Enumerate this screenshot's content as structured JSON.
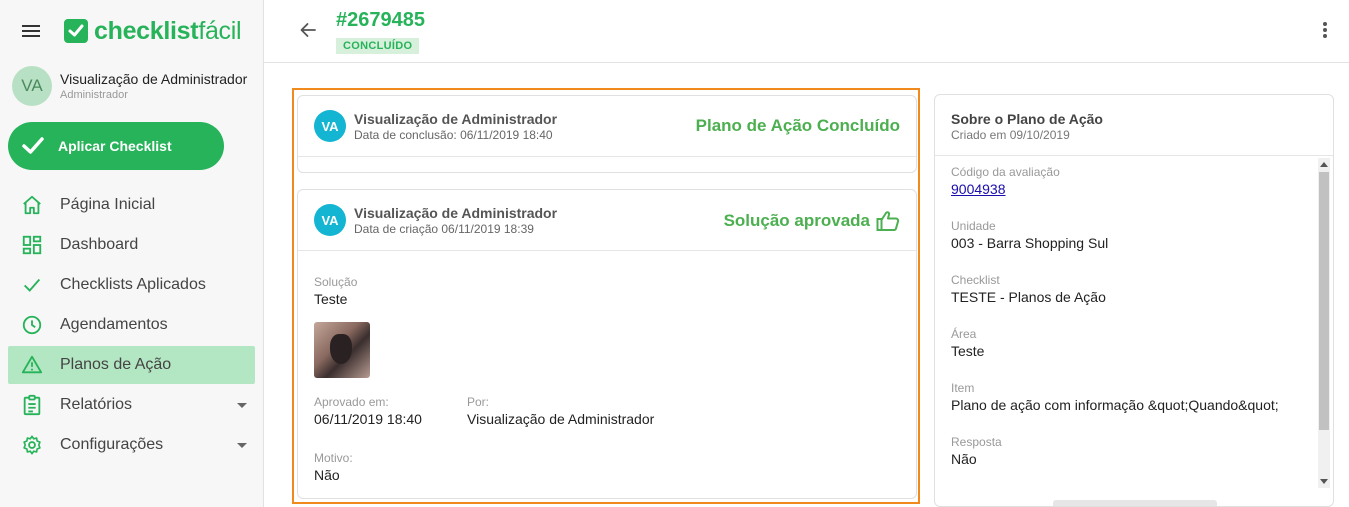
{
  "app": {
    "logo_bold": "checklist",
    "logo_light": "fácil"
  },
  "user": {
    "initials": "VA",
    "name": "Visualização de Administrador",
    "role": "Administrador"
  },
  "sidebar": {
    "apply_label": "Aplicar Checklist",
    "items": [
      {
        "label": "Página Inicial",
        "icon": "home-icon"
      },
      {
        "label": "Dashboard",
        "icon": "dashboard-icon"
      },
      {
        "label": "Checklists Aplicados",
        "icon": "check-icon"
      },
      {
        "label": "Agendamentos",
        "icon": "clock-icon"
      },
      {
        "label": "Planos de Ação",
        "icon": "warning-icon",
        "active": true
      },
      {
        "label": "Relatórios",
        "icon": "report-icon",
        "has_submenu": true
      },
      {
        "label": "Configurações",
        "icon": "gear-icon",
        "has_submenu": true
      }
    ]
  },
  "header": {
    "title": "#2679485",
    "status": "CONCLUÍDO"
  },
  "card1": {
    "initials": "VA",
    "user": "Visualização de Administrador",
    "date": "Data de conclusão: 06/11/2019 18:40",
    "status": "Plano de Ação Concluído"
  },
  "card2": {
    "initials": "VA",
    "user": "Visualização de Administrador",
    "date": "Data de criação 06/11/2019 18:39",
    "status": "Solução aprovada",
    "solution_label": "Solução",
    "solution_value": "Teste",
    "approved_label": "Aprovado em:",
    "approved_value": "06/11/2019 18:40",
    "by_label": "Por:",
    "by_value": "Visualização de Administrador",
    "reason_label": "Motivo:",
    "reason_value": "Não"
  },
  "panel": {
    "title": "Sobre o Plano de Ação",
    "subtitle": "Criado em 09/10/2019",
    "fields": [
      {
        "label": "Código da avaliação",
        "value": "9004938",
        "link": true
      },
      {
        "label": "Unidade",
        "value": "003 - Barra Shopping Sul"
      },
      {
        "label": "Checklist",
        "value": "TESTE - Planos de Ação"
      },
      {
        "label": "Área",
        "value": "Teste"
      },
      {
        "label": "Item",
        "value": "Plano de ação com informação &quot;Quando&quot;"
      },
      {
        "label": "Resposta",
        "value": "Não"
      }
    ]
  },
  "colors": {
    "brand": "#27b35a",
    "highlight": "#f08a1c",
    "avatar": "#13b5d3",
    "status_text": "#4caf50"
  }
}
